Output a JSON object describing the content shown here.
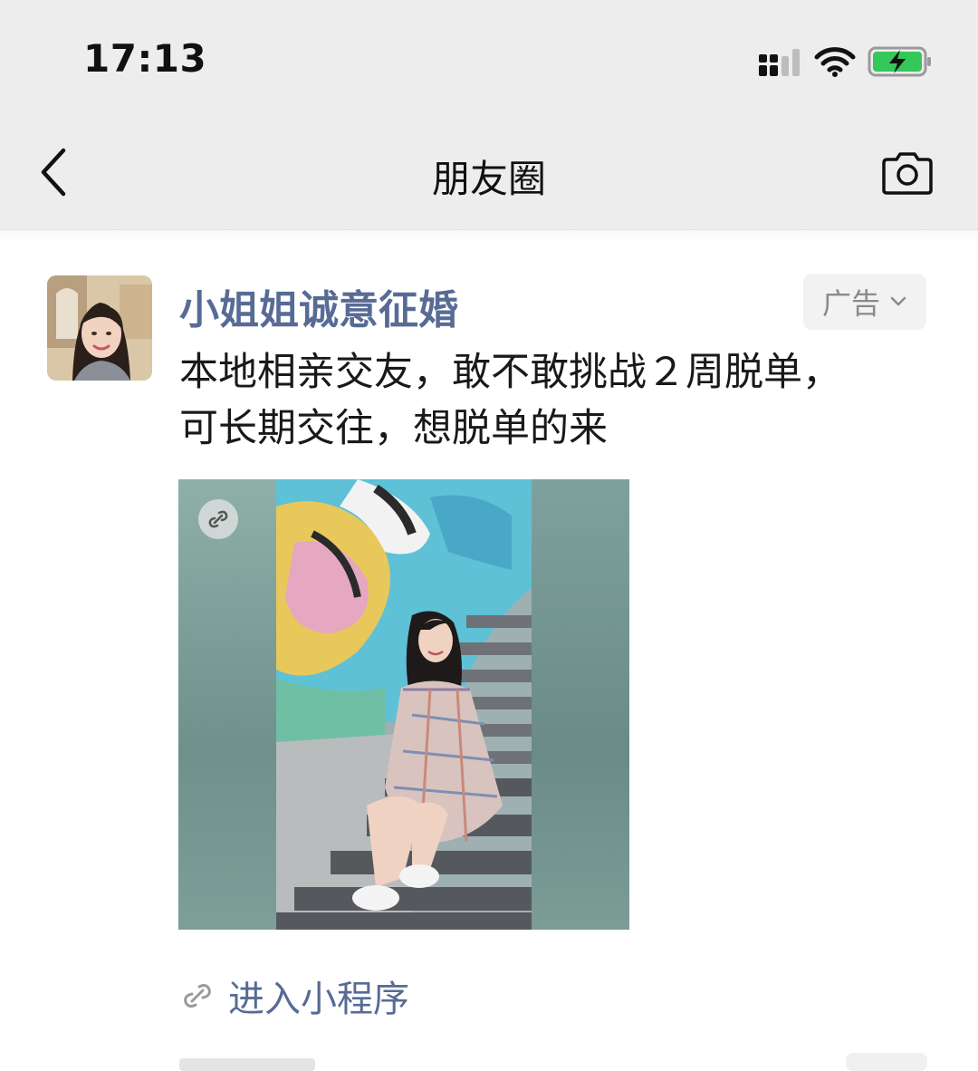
{
  "status_bar": {
    "time": "17:13",
    "signal_icon": "cellular-signal-icon",
    "wifi_icon": "wifi-icon",
    "battery_icon": "battery-charging-icon",
    "battery_color": "#34c759"
  },
  "nav": {
    "back_icon": "back-chevron-icon",
    "title": "朋友圈",
    "camera_icon": "camera-icon"
  },
  "post": {
    "author": "小姐姐诚意征婚",
    "ad_label": "广告",
    "text_lines": [
      "本地相亲交友，敢不敢挑战２周脱单，",
      "可长期交往，想脱单的来"
    ],
    "media_badge_icon": "mini-program-link-icon",
    "mini_program_label": "进入小程序"
  },
  "colors": {
    "link_blue": "#576b95",
    "topbar_bg": "#ededed"
  }
}
